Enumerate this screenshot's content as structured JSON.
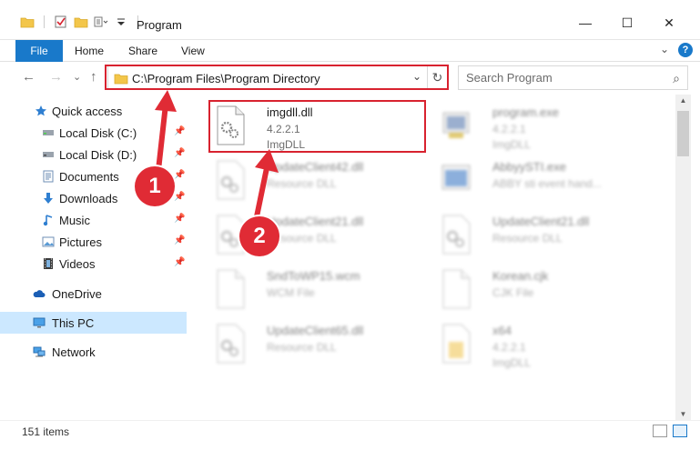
{
  "window": {
    "title": "Program",
    "minimize_glyph": "—",
    "maximize_glyph": "☐",
    "close_glyph": "✕"
  },
  "ribbon": {
    "tabs": [
      {
        "label": "File",
        "active": true
      },
      {
        "label": "Home"
      },
      {
        "label": "Share"
      },
      {
        "label": "View"
      }
    ],
    "expand_glyph": "⌄",
    "help_glyph": "?"
  },
  "nav": {
    "back_glyph": "←",
    "forward_glyph": "→",
    "recent_glyph": "⌄",
    "up_glyph": "↑",
    "address_path": "C:\\Program Files\\Program Directory",
    "address_chevron": "⌄",
    "refresh_glyph": "↻",
    "search_placeholder": "Search Program",
    "search_glyph": "⌕"
  },
  "sidebar": {
    "items": [
      {
        "label": "Quick access",
        "icon": "star-icon",
        "pinned": false
      },
      {
        "label": "Local Disk (C:)",
        "icon": "drive-icon",
        "pinned": true
      },
      {
        "label": "Local Disk (D:)",
        "icon": "drive-icon",
        "pinned": true
      },
      {
        "label": "Documents",
        "icon": "documents-icon",
        "pinned": true
      },
      {
        "label": "Downloads",
        "icon": "download-icon",
        "pinned": true
      },
      {
        "label": "Music",
        "icon": "music-icon",
        "pinned": true
      },
      {
        "label": "Pictures",
        "icon": "pictures-icon",
        "pinned": true
      },
      {
        "label": "Videos",
        "icon": "videos-icon",
        "pinned": true
      },
      {
        "label": "OneDrive",
        "icon": "cloud-icon",
        "pinned": false
      },
      {
        "label": "This PC",
        "icon": "computer-icon",
        "pinned": false,
        "selected": true
      },
      {
        "label": "Network",
        "icon": "network-icon",
        "pinned": false
      }
    ],
    "pin_glyph": "📌"
  },
  "files": [
    {
      "name": "imgdll.dll",
      "meta1": "4.2.2.1",
      "meta2": "ImgDLL",
      "highlighted": true
    },
    {
      "name": "program.exe",
      "meta1": "4.2.2.1",
      "meta2": "ImgDLL"
    },
    {
      "name": "UpdateClient42.dll",
      "meta1": "Resource DLL"
    },
    {
      "name": "AbbyySTI.exe",
      "meta1": "ABBY sti event hand..."
    },
    {
      "name": "UpdateClient21.dll",
      "meta1": "Resource DLL"
    },
    {
      "name": "UpdateClient21.dll",
      "meta1": "Resource DLL"
    },
    {
      "name": "SndToWP15.wcm",
      "meta1": "WCM File"
    },
    {
      "name": "Korean.cjk",
      "meta1": "CJK File"
    },
    {
      "name": "UpdateClient65.dll",
      "meta1": "Resource DLL"
    },
    {
      "name": "x64",
      "meta1": "4.2.2.1",
      "meta2": "ImgDLL"
    }
  ],
  "status": {
    "item_count": "151 items"
  },
  "callouts": [
    {
      "number": "1"
    },
    {
      "number": "2"
    }
  ],
  "colors": {
    "accent": "#1979ca",
    "callout_red": "#d8222f",
    "selected_bg": "#cce8ff"
  }
}
